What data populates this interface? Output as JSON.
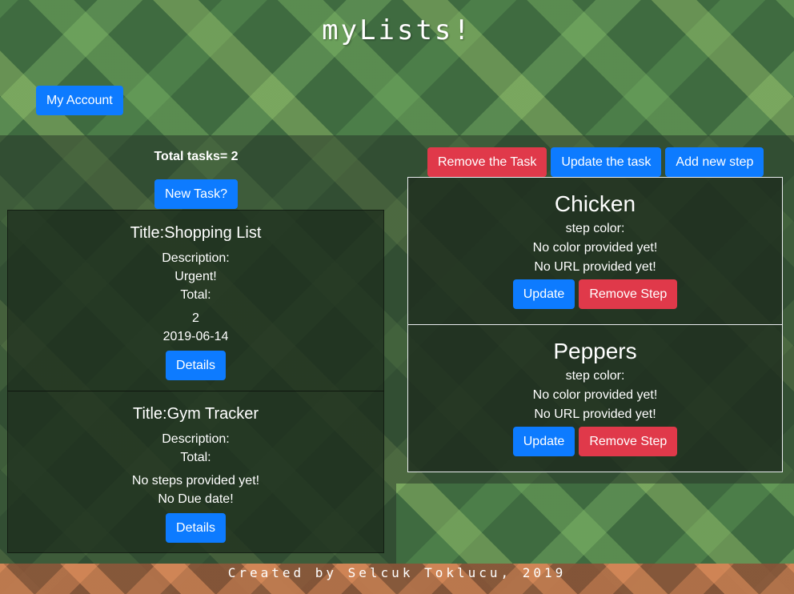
{
  "app": {
    "title": "myLists!"
  },
  "header": {
    "account_label": "My Account"
  },
  "tasks_panel": {
    "total_label": "Total tasks= 2",
    "new_task_label": "New Task?",
    "tasks": [
      {
        "title": "Title:Shopping List",
        "description_label": "Description:",
        "description": "Urgent!",
        "total_label": "Total:",
        "total": "2",
        "due_date": "2019-06-14",
        "details_label": "Details"
      },
      {
        "title": "Title:Gym Tracker",
        "description_label": "Description:",
        "total_label": "Total:",
        "steps_note": "No steps provided yet!",
        "due_date": "No Due date!",
        "details_label": "Details"
      }
    ]
  },
  "task_actions": {
    "remove_label": "Remove the Task",
    "update_label": "Update the task",
    "add_step_label": "Add new step"
  },
  "steps": [
    {
      "title": "Chicken",
      "color_label": "step color:",
      "color_value": "No color provided yet!",
      "url_value": "No URL provided yet!",
      "update_label": "Update",
      "remove_label": "Remove Step"
    },
    {
      "title": "Peppers",
      "color_label": "step color:",
      "color_value": "No color provided yet!",
      "url_value": "No URL provided yet!",
      "update_label": "Update",
      "remove_label": "Remove Step"
    }
  ],
  "footer": {
    "text": "Created by Selcuk Toklucu, 2019"
  },
  "colors": {
    "primary": "#0d7bff",
    "danger": "#e0394a",
    "background": "#3f6b40"
  }
}
